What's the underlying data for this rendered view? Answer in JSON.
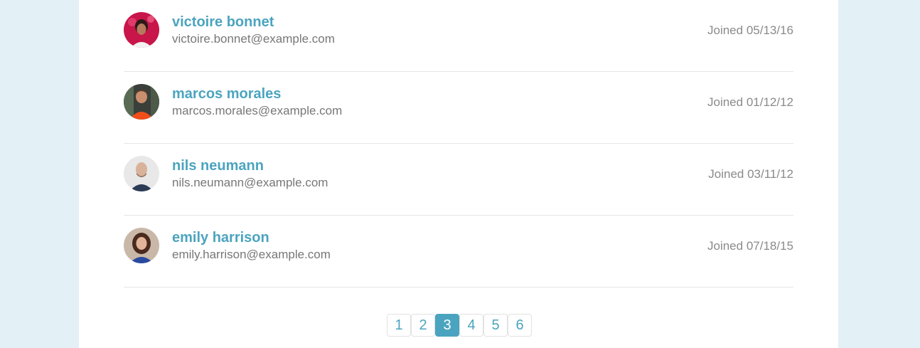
{
  "users": [
    {
      "name": "victoire bonnet",
      "email": "victoire.bonnet@example.com",
      "joined": "Joined 05/13/16",
      "avatar_icon": "user-avatar-photo"
    },
    {
      "name": "marcos morales",
      "email": "marcos.morales@example.com",
      "joined": "Joined 01/12/12",
      "avatar_icon": "user-avatar-photo"
    },
    {
      "name": "nils neumann",
      "email": "nils.neumann@example.com",
      "joined": "Joined 03/11/12",
      "avatar_icon": "user-avatar-photo"
    },
    {
      "name": "emily harrison",
      "email": "emily.harrison@example.com",
      "joined": "Joined 07/18/15",
      "avatar_icon": "user-avatar-photo"
    }
  ],
  "pagination": {
    "pages": [
      "1",
      "2",
      "3",
      "4",
      "5",
      "6"
    ],
    "current": "3"
  },
  "colors": {
    "accent": "#4ba4bf",
    "background": "#e3f0f6",
    "panel": "#ffffff"
  }
}
